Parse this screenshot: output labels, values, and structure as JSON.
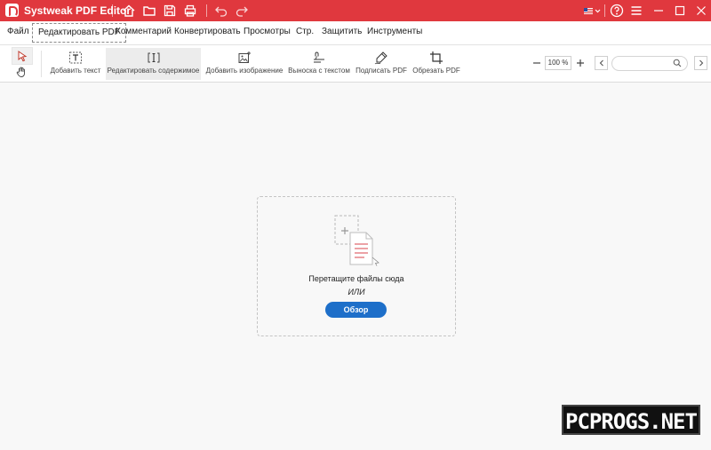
{
  "app": {
    "title": "Systweak PDF Editor"
  },
  "menu": {
    "items": [
      "Файл",
      "Редактировать PDF",
      "Комментарий",
      "Конвертировать",
      "Просмотры",
      "Стр.",
      "Защитить",
      "Инструменты"
    ],
    "active_index": 1
  },
  "toolbar": {
    "tools": [
      {
        "label": "Добавить текст",
        "icon": "add-text-icon"
      },
      {
        "label": "Редактировать содержимое",
        "icon": "edit-content-icon",
        "selected": true
      },
      {
        "label": "Добавить изображение",
        "icon": "add-image-icon"
      },
      {
        "label": "Выноска с текстом",
        "icon": "callout-icon"
      },
      {
        "label": "Подписать PDF",
        "icon": "sign-icon"
      },
      {
        "label": "Обрезать PDF",
        "icon": "crop-icon"
      }
    ],
    "zoom_value": "100 %",
    "search_placeholder": ""
  },
  "dropzone": {
    "text": "Перетащите файлы сюда",
    "or_text": "ИЛИ",
    "browse_label": "Обзор"
  },
  "watermark": {
    "text": "PCPROGS.NET"
  },
  "colors": {
    "titlebar": "#e0383e",
    "accent": "#1e6fc9"
  }
}
